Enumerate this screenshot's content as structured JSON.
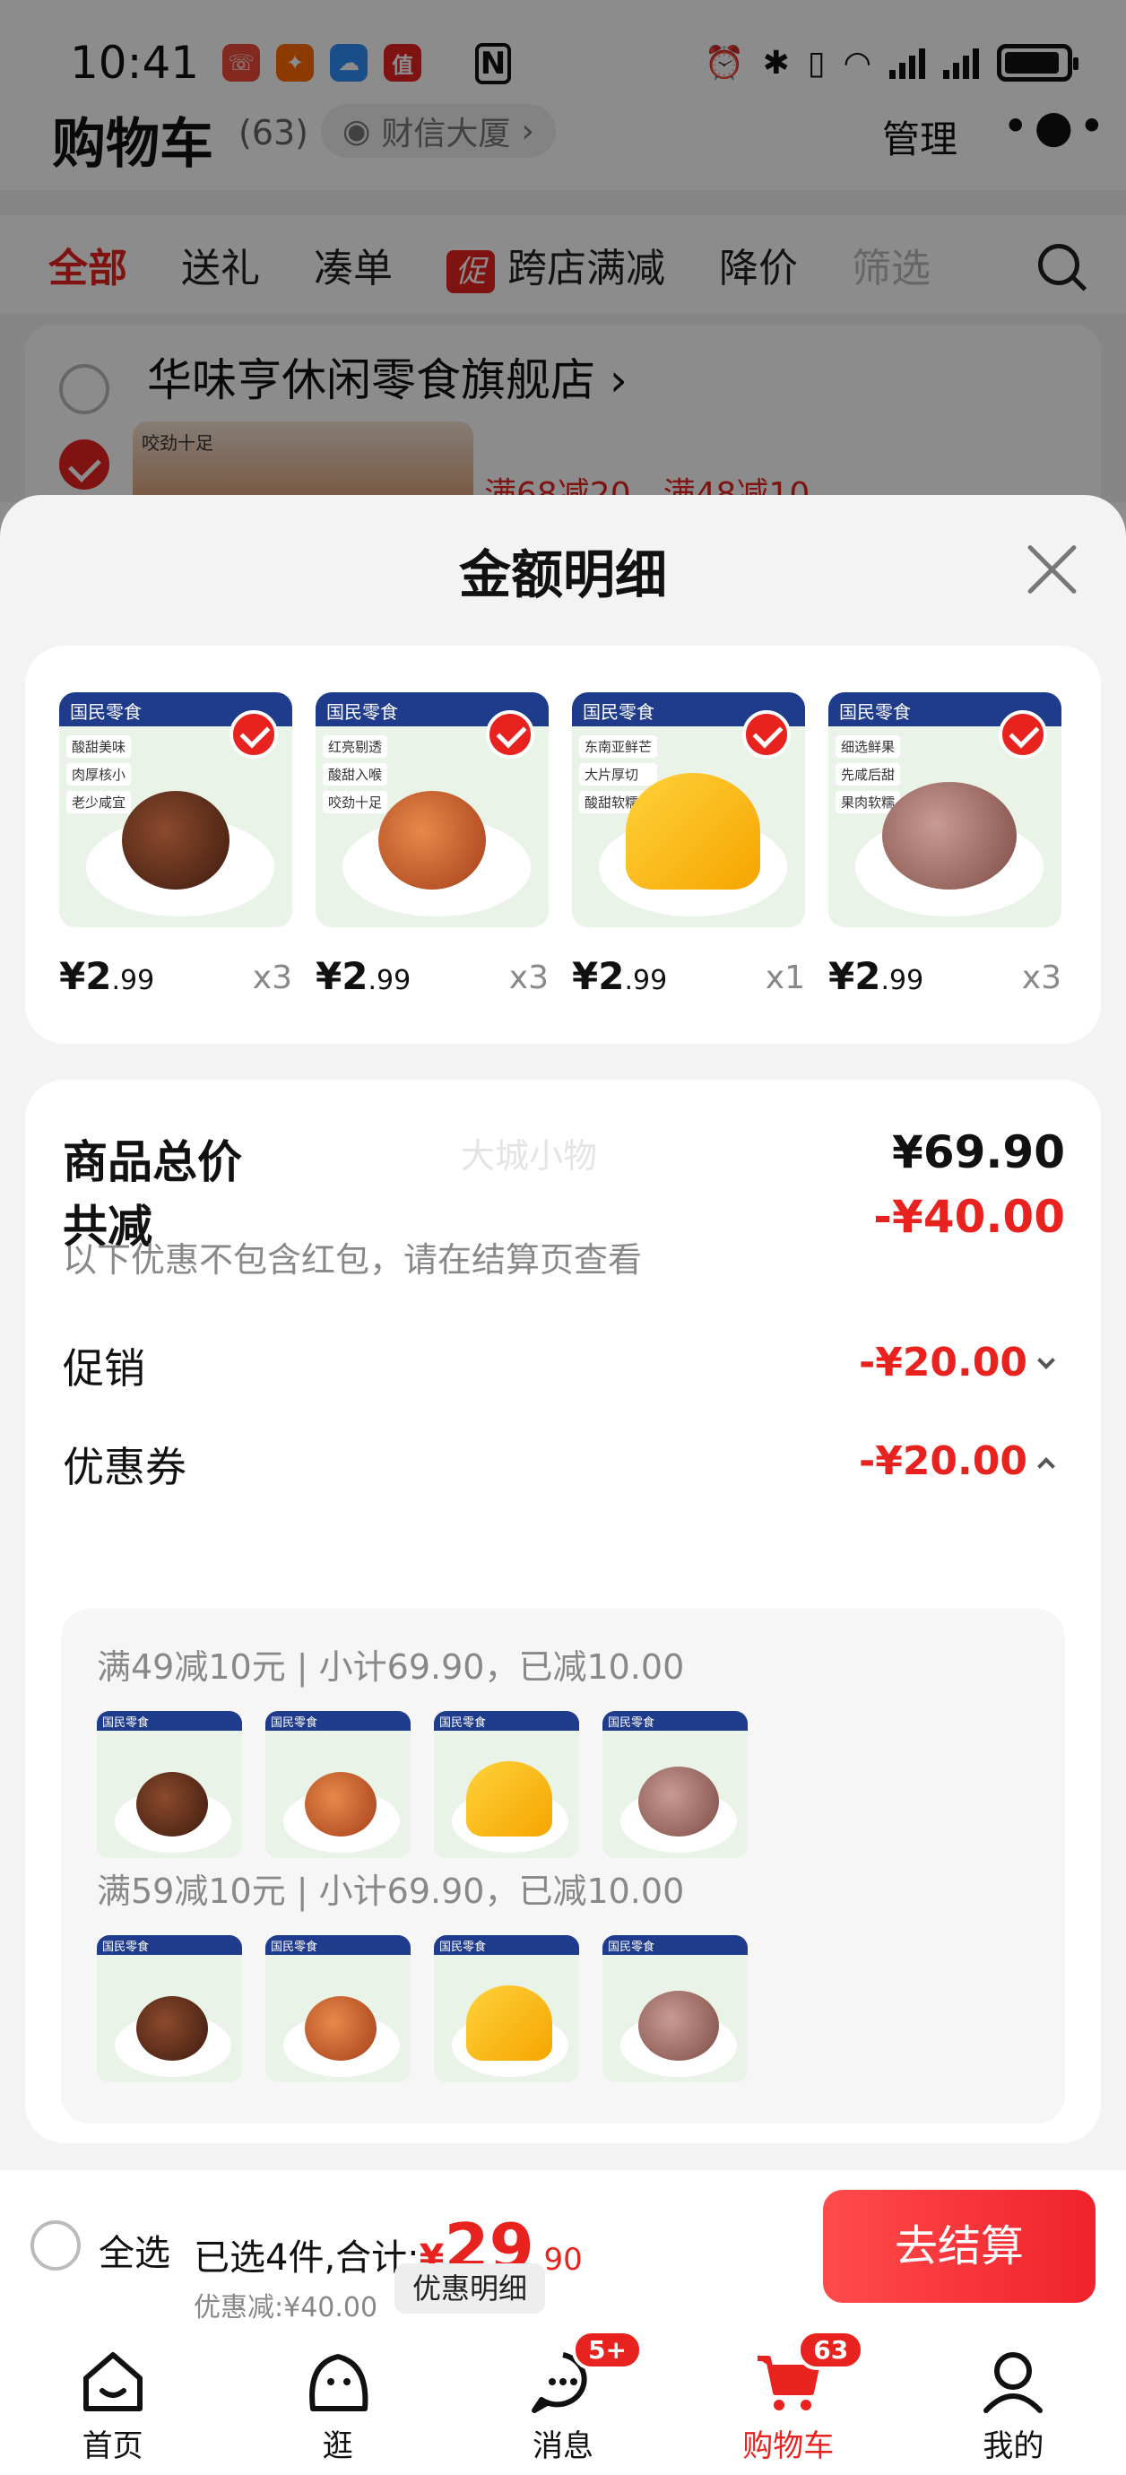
{
  "status_bar": {
    "time": "10:41",
    "app_badges": [
      "☏",
      "✦",
      "☁",
      "值"
    ]
  },
  "cart_header": {
    "title": "购物车",
    "count": "(63)",
    "address": "财信大厦",
    "manage": "管理"
  },
  "filter_tabs": [
    "全部",
    "送礼",
    "凑单",
    "跨店满减",
    "降价",
    "筛选"
  ],
  "promo_tag": "促",
  "store": {
    "name": "华味亨休闲零食旗舰店",
    "thumb_text": "咬劲十足",
    "promo": "满68减20，满48减10"
  },
  "sheet": {
    "title": "金额明细",
    "products": [
      {
        "price_int": "¥2",
        "price_dec": ".99",
        "qty": "x3",
        "brand": "国民零食",
        "tags": [
          "酸甜美味",
          "肉厚核小",
          "老少咸宜"
        ]
      },
      {
        "price_int": "¥2",
        "price_dec": ".99",
        "qty": "x3",
        "brand": "国民零食",
        "tags": [
          "红亮剔透",
          "酸甜入喉",
          "咬劲十足"
        ]
      },
      {
        "price_int": "¥2",
        "price_dec": ".99",
        "qty": "x1",
        "brand": "国民零食",
        "tags": [
          "东南亚鲜芒",
          "大片厚切",
          "酸甜软糯"
        ]
      },
      {
        "price_int": "¥2",
        "price_dec": ".99",
        "qty": "x3",
        "brand": "国民零食",
        "tags": [
          "细选鲜果",
          "先咸后甜",
          "果肉软糯"
        ]
      }
    ],
    "summary": {
      "total_label": "商品总价",
      "total_value": "¥69.90",
      "watermark": "大城小物",
      "discount_label": "共减",
      "discount_value": "-¥40.00",
      "note": "以下优惠不包含红包，请在结算页查看",
      "promo_label": "促销",
      "promo_value": "-¥20.00",
      "coupon_label": "优惠券",
      "coupon_value": "-¥20.00",
      "coupons": [
        {
          "text": "满49减10元 | 小计69.90，已减10.00"
        },
        {
          "text": "满59减10元 | 小计69.90，已减10.00"
        }
      ]
    }
  },
  "checkout": {
    "select_all": "全选",
    "selected_prefix": "已选4件,合计:",
    "currency": "¥",
    "amount_int": "29",
    "amount_dec": ".90",
    "discount_text": "优惠减:¥40.00",
    "detail_button": "优惠明细",
    "submit": "去结算"
  },
  "tabbar": [
    {
      "label": "首页",
      "icon": "home-icon"
    },
    {
      "label": "逛",
      "icon": "explore-icon"
    },
    {
      "label": "消息",
      "icon": "message-icon",
      "badge": "5+"
    },
    {
      "label": "购物车",
      "icon": "cart-icon",
      "badge": "63",
      "active": true
    },
    {
      "label": "我的",
      "icon": "profile-icon"
    }
  ],
  "colors": {
    "accent": "#e8231f",
    "text": "#111111",
    "muted": "#888888"
  }
}
